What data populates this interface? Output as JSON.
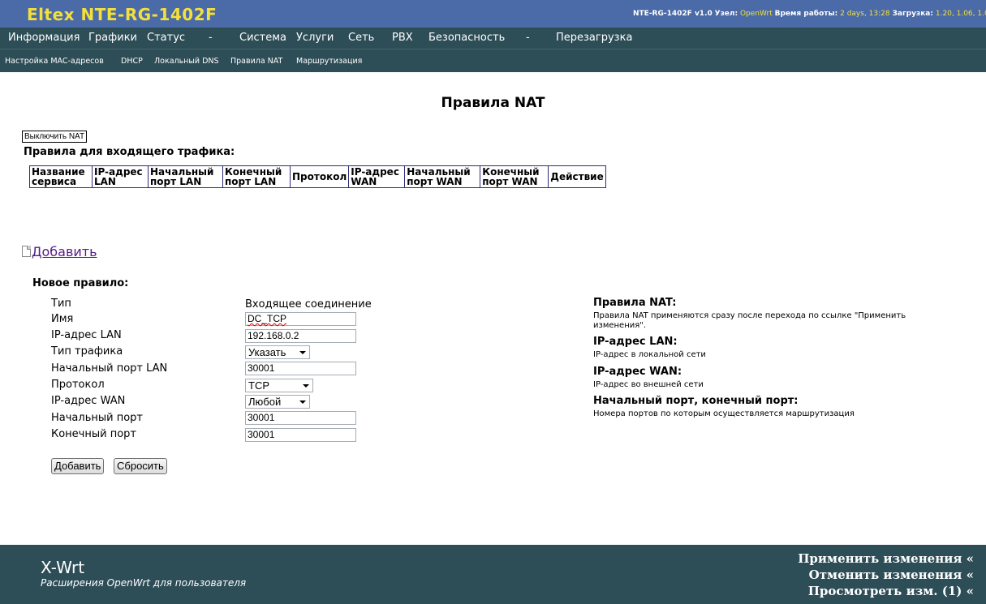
{
  "header": {
    "title": "Eltex NTE-RG-1402F",
    "status": {
      "device": "NTE-RG-1402F v1.0",
      "node_label": "Узел:",
      "node_value": "OpenWrt",
      "uptime_label": "Время работы:",
      "uptime_value": "2 days, 13:28",
      "load_label": "Загрузка:",
      "load_value": "1.20, 1.06, 1.0"
    }
  },
  "nav_main": [
    "Информация",
    "Графики",
    "Статус",
    "-",
    "Система",
    "Услуги",
    "Сеть",
    "PBX",
    "Безопасность",
    "-",
    "Перезагрузка"
  ],
  "nav_sub": [
    "Настройка MAC-адресов",
    "DHCP",
    "Локальный DNS",
    "Правила NAT",
    "Маршрутизация"
  ],
  "page": {
    "title": "Правила NAT",
    "disable_button": "Выключить NAT",
    "incoming_title": "Правила для входящего трафика:",
    "table_headers": [
      [
        "Название",
        "сервиса"
      ],
      [
        "IP-адрес",
        "LAN"
      ],
      [
        "Начальный",
        "порт LAN"
      ],
      [
        "Конечный",
        "порт LAN"
      ],
      [
        "Протокол"
      ],
      [
        "IP-адрес",
        "WAN"
      ],
      [
        "Начальный",
        "порт WAN"
      ],
      [
        "Конечный",
        "порт WAN"
      ],
      [
        "Действие"
      ]
    ],
    "add_link": "Добавить",
    "new_rule_title": "Новое правило:"
  },
  "form": {
    "type_label": "Тип",
    "type_value": "Входящее соединение",
    "name_label": "Имя",
    "name_value": "DC_TCP",
    "lan_ip_label": "IP-адрес LAN",
    "lan_ip_value": "192.168.0.2",
    "traffic_label": "Тип трафика",
    "traffic_value": "Указать",
    "lan_port_label": "Начальный порт LAN",
    "lan_port_value": "30001",
    "proto_label": "Протокол",
    "proto_value": "TCP",
    "wan_ip_label": "IP-адрес WAN",
    "wan_ip_value": "Любой",
    "start_port_label": "Начальный порт",
    "start_port_value": "30001",
    "end_port_label": "Конечный порт",
    "end_port_value": "30001",
    "add_button": "Добавить",
    "reset_button": "Сбросить"
  },
  "help": [
    {
      "title": "Правила NAT:",
      "text": "Правила NAT применяются сразу после перехода по ссылке \"Применить изменения\"."
    },
    {
      "title": "IP-адрес LAN:",
      "text": "IP-адрес в локальной сети"
    },
    {
      "title": "IP-адрес WAN:",
      "text": "IP-адрес во внешней сети"
    },
    {
      "title": "Начальный порт, конечный порт:",
      "text": "Номера портов по которым осуществляется маршрутизация"
    }
  ],
  "footer": {
    "brand": "X-Wrt",
    "subtitle": "Расширения OpenWrt для пользователя",
    "apply": "Применить изменения «",
    "revert": "Отменить изменения «",
    "review": "Просмотреть изм. (1) «"
  },
  "colors": {
    "header_bg": "#4a6aa8",
    "title_yellow": "#f3e03a",
    "nav_bg": "#2d4d57",
    "link_purple": "#551a8b"
  }
}
